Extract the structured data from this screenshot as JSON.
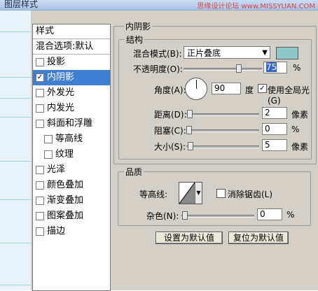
{
  "window": {
    "title": "图层样式",
    "watermark": "思缘设计论坛 www.MISSYUAN.COM"
  },
  "stylelist": {
    "header": "样式",
    "blend": "混合选项:默认",
    "items": [
      {
        "label": "投影",
        "checked": false,
        "selected": false,
        "indent": false
      },
      {
        "label": "内阴影",
        "checked": true,
        "selected": true,
        "indent": false
      },
      {
        "label": "外发光",
        "checked": false,
        "selected": false,
        "indent": false
      },
      {
        "label": "内发光",
        "checked": false,
        "selected": false,
        "indent": false
      },
      {
        "label": "斜面和浮雕",
        "checked": false,
        "selected": false,
        "indent": false
      },
      {
        "label": "等高线",
        "checked": false,
        "selected": false,
        "indent": true
      },
      {
        "label": "纹理",
        "checked": false,
        "selected": false,
        "indent": true
      },
      {
        "label": "光泽",
        "checked": false,
        "selected": false,
        "indent": false
      },
      {
        "label": "颜色叠加",
        "checked": false,
        "selected": false,
        "indent": false
      },
      {
        "label": "渐变叠加",
        "checked": false,
        "selected": false,
        "indent": false
      },
      {
        "label": "图案叠加",
        "checked": false,
        "selected": false,
        "indent": false
      },
      {
        "label": "描边",
        "checked": false,
        "selected": false,
        "indent": false
      }
    ]
  },
  "inner_shadow": {
    "title": "内阴影",
    "structure": {
      "title": "结构",
      "blend_mode_label": "混合模式(B):",
      "blend_mode_value": "正片叠底",
      "shadow_color": "#8cc8c8",
      "opacity_label": "不透明度(O):",
      "opacity_value": "75",
      "opacity_unit": "%",
      "opacity_fraction": 0.75,
      "angle_label": "角度(A):",
      "angle_value": "90",
      "angle_unit": "度",
      "global_light_label": "使用全局光(G)",
      "global_light_checked": true,
      "distance_label": "距离(D):",
      "distance_value": "2",
      "distance_unit": "像素",
      "choke_label": "阻塞(C):",
      "choke_value": "0",
      "choke_unit": "%",
      "size_label": "大小(S):",
      "size_value": "5",
      "size_unit": "像素"
    },
    "quality": {
      "title": "品质",
      "contour_label": "等高线:",
      "antialias_label": "消除锯齿(L)",
      "antialias_checked": false,
      "noise_label": "杂色(N):",
      "noise_value": "0",
      "noise_unit": "%"
    },
    "buttons": {
      "make_default": "设置为默认值",
      "reset_default": "复位为默认值"
    }
  }
}
